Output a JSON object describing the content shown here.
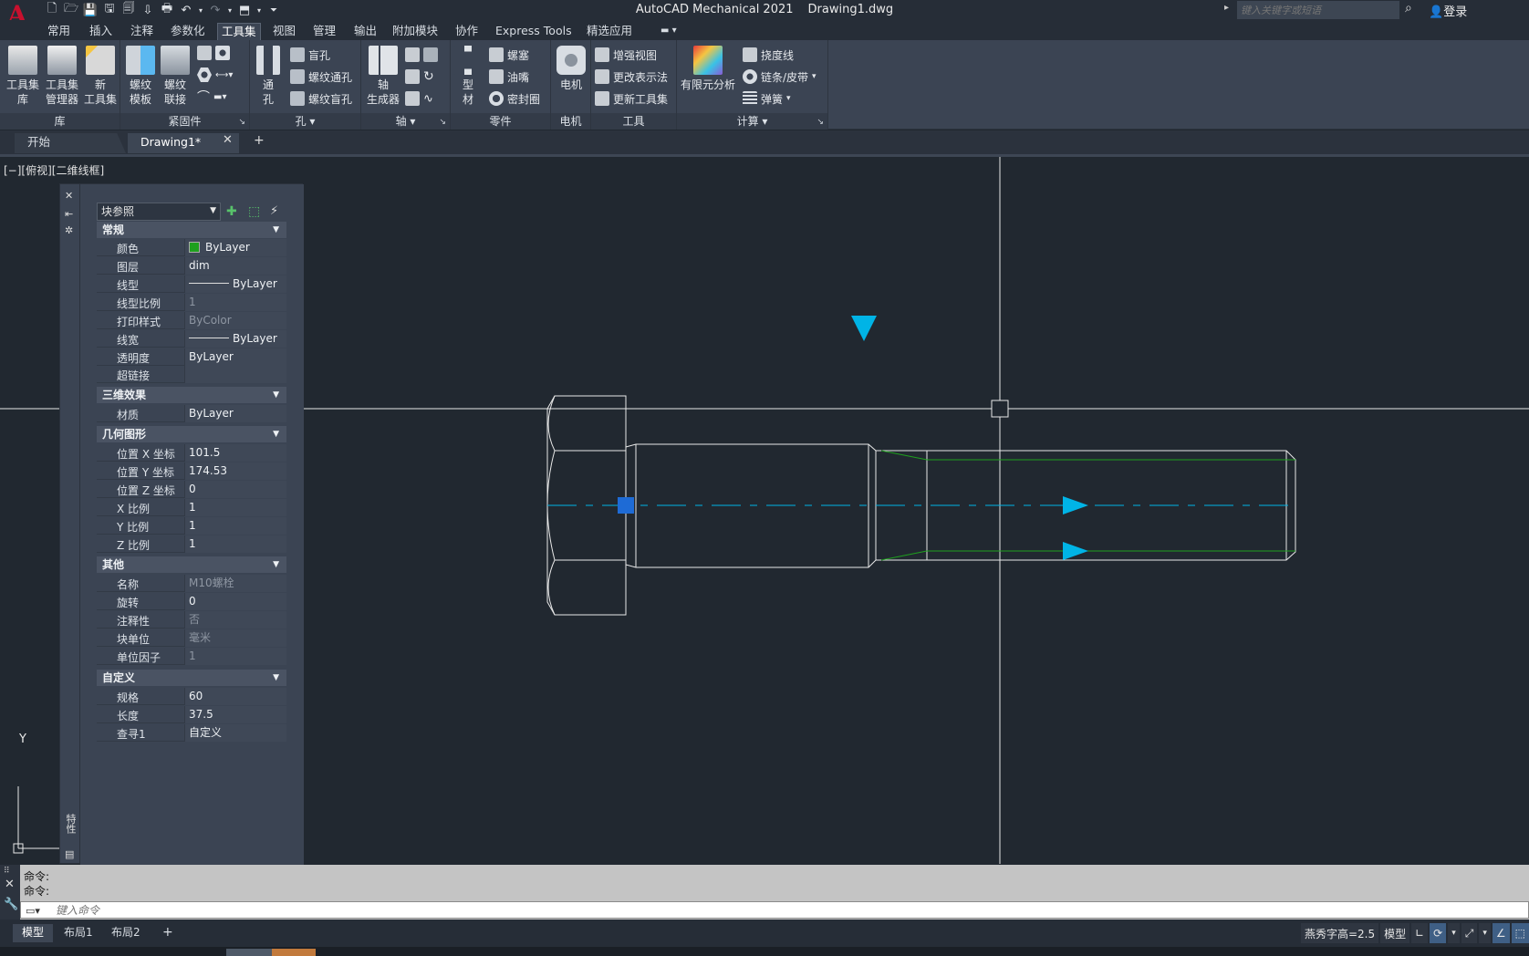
{
  "app": {
    "name": "AutoCAD Mechanical 2021",
    "file": "Drawing1.dwg",
    "logo": "A",
    "logo_sub": "M",
    "search_placeholder": "键入关键字或短语",
    "login": "登录"
  },
  "menu_tabs": [
    "常用",
    "插入",
    "注释",
    "参数化",
    "工具集",
    "视图",
    "管理",
    "输出",
    "附加模块",
    "协作",
    "Express Tools",
    "精选应用"
  ],
  "active_menu_tab": "工具集",
  "ribbon": {
    "lib": {
      "label": "库",
      "btn1": "工具集\n库",
      "btn2": "工具集\n管理器",
      "btn3": "新\n工具集"
    },
    "fasteners": {
      "label": "紧固件",
      "btn1": "螺纹\n模板",
      "btn2": "螺纹\n联接"
    },
    "holes": {
      "label": "孔",
      "big": "通\n孔",
      "s1": "盲孔",
      "s2": "螺纹通孔",
      "s3": "螺纹盲孔"
    },
    "shaft": {
      "label": "轴",
      "big": "轴\n生成器"
    },
    "parts": {
      "label": "零件",
      "big": "型\n材",
      "s1": "螺塞",
      "s2": "油嘴",
      "s3": "密封圈"
    },
    "motor": {
      "label": "电机",
      "big": "电机"
    },
    "tools": {
      "label": "工具",
      "s1": "增强视图",
      "s2": "更改表示法",
      "s3": "更新工具集"
    },
    "calc": {
      "label": "计算",
      "big": "有限元分析",
      "s1": "挠度线",
      "s2": "链条/皮带",
      "s3": "弹簧"
    }
  },
  "doc_tabs": {
    "start": "开始",
    "drawing": "Drawing1*"
  },
  "viewport_control": "[−][俯视][二维线框]",
  "palette": {
    "title": "特性",
    "selection": "块参照",
    "categories": {
      "general": {
        "title": "常规",
        "rows": [
          {
            "k": "颜色",
            "v": "ByLayer"
          },
          {
            "k": "图层",
            "v": "dim"
          },
          {
            "k": "线型",
            "v": "ByLayer"
          },
          {
            "k": "线型比例",
            "v": "1"
          },
          {
            "k": "打印样式",
            "v": "ByColor"
          },
          {
            "k": "线宽",
            "v": "ByLayer"
          },
          {
            "k": "透明度",
            "v": "ByLayer"
          },
          {
            "k": "超链接",
            "v": ""
          }
        ]
      },
      "effects3d": {
        "title": "三维效果",
        "rows": [
          {
            "k": "材质",
            "v": "ByLayer"
          }
        ]
      },
      "geometry": {
        "title": "几何图形",
        "rows": [
          {
            "k": "位置 X 坐标",
            "v": "101.5"
          },
          {
            "k": "位置 Y 坐标",
            "v": "174.53"
          },
          {
            "k": "位置 Z 坐标",
            "v": "0"
          },
          {
            "k": "X 比例",
            "v": "1"
          },
          {
            "k": "Y 比例",
            "v": "1"
          },
          {
            "k": "Z 比例",
            "v": "1"
          }
        ]
      },
      "misc": {
        "title": "其他",
        "rows": [
          {
            "k": "名称",
            "v": "M10螺栓"
          },
          {
            "k": "旋转",
            "v": "0"
          },
          {
            "k": "注释性",
            "v": "否"
          },
          {
            "k": "块单位",
            "v": "毫米"
          },
          {
            "k": "单位因子",
            "v": "1"
          }
        ]
      },
      "custom": {
        "title": "自定义",
        "rows": [
          {
            "k": "规格",
            "v": "60"
          },
          {
            "k": "长度",
            "v": "37.5"
          },
          {
            "k": "查寻1",
            "v": "自定义"
          }
        ]
      }
    }
  },
  "ucs": {
    "y": "Y"
  },
  "command": {
    "history1": "命令:",
    "history2": "命令:",
    "placeholder": "键入命令"
  },
  "layout_tabs": [
    "模型",
    "布局1",
    "布局2"
  ],
  "status": {
    "annotation": "燕秀字高=2.5",
    "model": "模型"
  },
  "colors": {
    "background": "#212830",
    "ribbon": "#3b4453",
    "accent_cyan": "#00b4e6",
    "green": "#1ea01e",
    "grip": "#1e6bd6"
  }
}
